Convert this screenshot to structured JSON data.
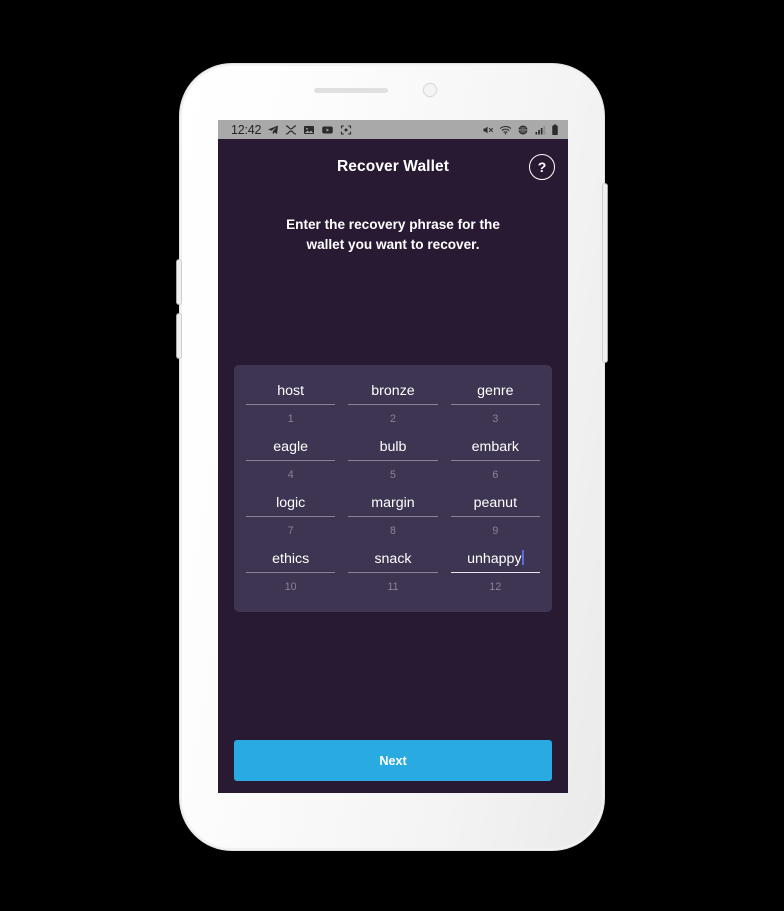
{
  "status_bar": {
    "time": "12:42",
    "left_icons": [
      "telegram-send-icon",
      "shuffle-x-icon",
      "image-icon",
      "youtube-play-icon",
      "screenshot-crop-icon"
    ],
    "right_icons": [
      "mute-icon",
      "wifi-icon",
      "sync-rotate-icon",
      "signal-bars-icon",
      "battery-icon"
    ]
  },
  "app_bar": {
    "title": "Recover Wallet",
    "help_label": "?"
  },
  "instruction": {
    "line1": "Enter the recovery phrase for the",
    "line2": "wallet you want to recover."
  },
  "recovery_phrase": {
    "words": [
      {
        "num": "1",
        "word": "host",
        "focused": false
      },
      {
        "num": "2",
        "word": "bronze",
        "focused": false
      },
      {
        "num": "3",
        "word": "genre",
        "focused": false
      },
      {
        "num": "4",
        "word": "eagle",
        "focused": false
      },
      {
        "num": "5",
        "word": "bulb",
        "focused": false
      },
      {
        "num": "6",
        "word": "embark",
        "focused": false
      },
      {
        "num": "7",
        "word": "logic",
        "focused": false
      },
      {
        "num": "8",
        "word": "margin",
        "focused": false
      },
      {
        "num": "9",
        "word": "peanut",
        "focused": false
      },
      {
        "num": "10",
        "word": "ethics",
        "focused": false
      },
      {
        "num": "11",
        "word": "snack",
        "focused": false
      },
      {
        "num": "12",
        "word": "unhappy",
        "focused": true
      }
    ]
  },
  "next_button": {
    "label": "Next"
  },
  "colors": {
    "screen_background": "#281a33",
    "panel_background": "#3e3552",
    "accent_button": "#29abe2",
    "status_bar": "#a9a9a9",
    "number_text": "#8b8399",
    "underline": "#8a8398",
    "underline_focused": "#e8e5ee",
    "caret": "#5c6bdd",
    "phone_body": "#f2f2f2"
  }
}
